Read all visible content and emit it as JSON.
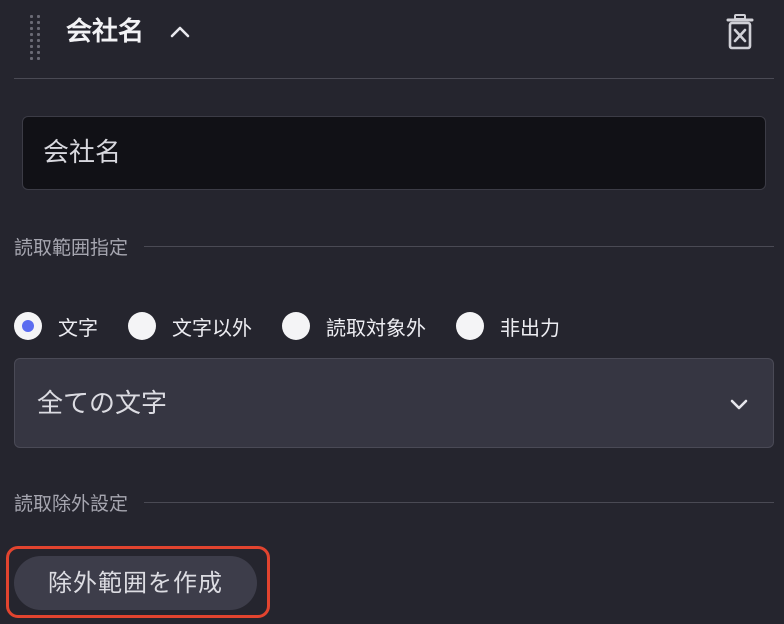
{
  "header": {
    "title": "会社名",
    "icons": {
      "drag": "drag-handle-icon",
      "collapse": "chevron-up-icon",
      "delete": "trash-icon"
    }
  },
  "name_field": {
    "value": "会社名"
  },
  "read_range": {
    "section_label": "読取範囲指定",
    "options": [
      {
        "label": "文字",
        "checked": true
      },
      {
        "label": "文字以外",
        "checked": false
      },
      {
        "label": "読取対象外",
        "checked": false
      },
      {
        "label": "非出力",
        "checked": false
      }
    ],
    "select_value": "全ての文字"
  },
  "exclusion": {
    "section_label": "読取除外設定",
    "create_button": "除外範囲を作成"
  },
  "colors": {
    "background": "#25252e",
    "radio_accent": "#5b6cf0",
    "highlight": "#e2442f"
  }
}
